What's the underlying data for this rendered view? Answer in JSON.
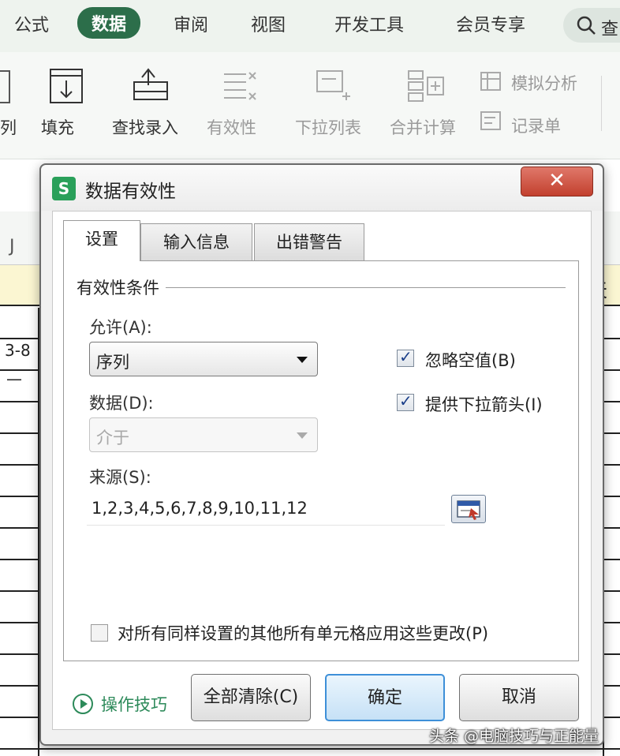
{
  "menubar": {
    "items": [
      "公式",
      "数据",
      "审阅",
      "视图",
      "开发工具",
      "会员专享"
    ],
    "active": "数据",
    "search_text": "查"
  },
  "ribbon": {
    "partial_label": "列",
    "fill": "填充",
    "find_entry": "查找录入",
    "validity": "有效性",
    "dropdown_list": "下拉列表",
    "consolidate": "合并计算",
    "what_if": "模拟分析",
    "record_form": "记录单"
  },
  "sheet": {
    "column_header": "J",
    "cell_partial": "3-8",
    "cell_dash": "—",
    "right_edge_text": "天"
  },
  "dialog": {
    "title": "数据有效性",
    "app_logo": "S",
    "close_glyph": "✕",
    "tabs": [
      "设置",
      "输入信息",
      "出错警告"
    ],
    "active_tab": "设置",
    "group_title": "有效性条件",
    "allow_label": "允许(A):",
    "allow_value": "序列",
    "data_label": "数据(D):",
    "data_value": "介于",
    "ignore_blank_label": "忽略空值(B)",
    "ignore_blank_checked": true,
    "dropdown_arrow_label": "提供下拉箭头(I)",
    "dropdown_arrow_checked": true,
    "source_label": "来源(S):",
    "source_value": "1,2,3,4,5,6,7,8,9,10,11,12",
    "apply_all_label": "对所有同样设置的其他所有单元格应用这些更改(P)",
    "apply_all_checked": false,
    "tips_label": "操作技巧",
    "clear_all_label": "全部清除(C)",
    "ok_label": "确定",
    "cancel_label": "取消"
  },
  "watermark": "头条 @电脑技巧与正能量",
  "colors": {
    "accent_green": "#2c6e4a",
    "tips_green": "#2d8a5a",
    "close_red": "#c2402e",
    "primary_blue": "#3d8fd8"
  },
  "icons": [
    "search-icon",
    "fill-icon",
    "find-entry-icon",
    "validity-icon",
    "dropdown-list-icon",
    "consolidate-icon",
    "what-if-icon",
    "record-form-icon",
    "range-select-icon",
    "play-circle-icon"
  ]
}
